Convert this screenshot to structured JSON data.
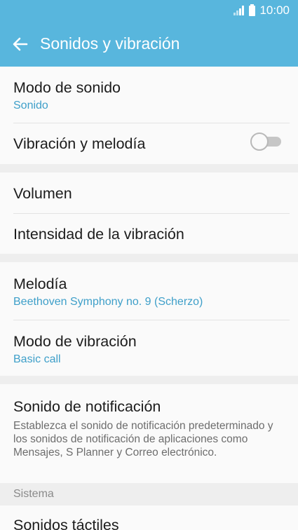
{
  "status_bar": {
    "time": "10:00",
    "icons": [
      "signal-icon",
      "battery-icon"
    ]
  },
  "header": {
    "back_icon": "arrow-left-icon",
    "title": "Sonidos y vibración"
  },
  "colors": {
    "accent": "#58b6dd",
    "subtitle": "#3e9fc9",
    "background": "#f6f6f6"
  },
  "settings": {
    "sound_mode": {
      "title": "Modo de sonido",
      "value": "Sonido"
    },
    "vibrate_with_ringtone": {
      "title": "Vibración y melodía",
      "enabled": false
    },
    "volume": {
      "title": "Volumen"
    },
    "vibration_intensity": {
      "title": "Intensidad de la vibración"
    },
    "ringtone": {
      "title": "Melodía",
      "value": "Beethoven Symphony no. 9 (Scherzo)"
    },
    "vibration_pattern": {
      "title": "Modo de vibración",
      "value": "Basic call"
    },
    "notification_sound": {
      "title": "Sonido de notificación",
      "description": "Establezca el sonido de notificación predeterminado y los sonidos de notificación de aplicaciones como Mensajes, S Planner y Correo electrónico."
    },
    "system_section": {
      "header": "Sistema"
    },
    "touch_sounds": {
      "title": "Sonidos táctiles"
    }
  }
}
